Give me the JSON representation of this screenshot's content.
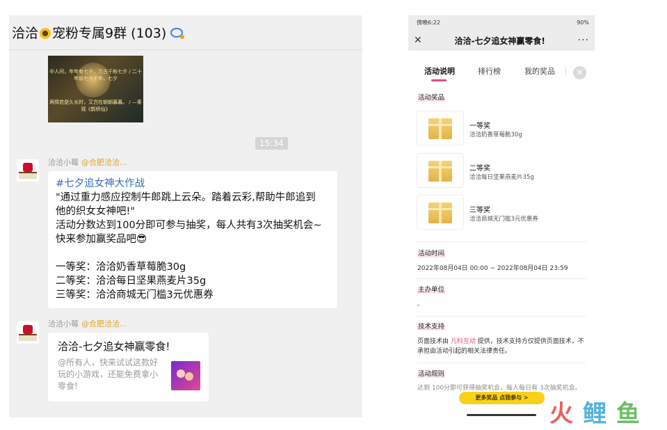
{
  "chat": {
    "title": "洽洽",
    "title_suffix": "宠粉专属9群 (103)",
    "image_caption_top": "中人间，年年有七夕，万古千秋七夕 / 二十年前七夕千年，七夕",
    "image_caption_bottom": "两情若是久长时，又岂在朝朝暮暮。 / —秦观《鹊桥仙》",
    "time": "15:34",
    "messages": [
      {
        "sender": "洽洽小莓",
        "group": "@合肥洽洽...",
        "hashtag": "#七夕追女神大作战",
        "body": "\"通过重力感应控制牛郎跳上云朵。踏着云彩,帮助牛郎追到\n他的织女女神吧!\"\n活动分数达到100分即可参与抽奖，每人共有3次抽奖机会~\n快来参加赢奖品吧😎\n\n一等奖：洽洽奶香草莓脆30g\n二等奖：洽洽每日坚果燕麦片35g\n三等奖：洽洽商城无门槛3元优惠券"
      },
      {
        "sender": "洽洽小莓",
        "group": "@合肥洽洽...",
        "card_title": "洽洽-七夕追女神赢零食!",
        "card_desc": "@所有人，快来试试这款好玩的小游戏，还能免费拿小零食!"
      }
    ]
  },
  "phone": {
    "status_left": "傍晚6:22",
    "status_right": "90%",
    "nav_title": "洽洽-七夕追女神赢零食!",
    "nav_close": "✕",
    "nav_more": "···",
    "tabs": [
      "活动说明",
      "排行榜",
      "我的奖品"
    ],
    "active_tab": "活动说明",
    "close_icon": "✕",
    "sections": {
      "prizes_label": "活动奖品",
      "prizes": [
        {
          "name": "一等奖",
          "desc": "洽洽奶香草莓脆30g"
        },
        {
          "name": "二等奖",
          "desc": "洽洽每日坚果燕麦片35g"
        },
        {
          "name": "三等奖",
          "desc": "洽洽商城无门槛3元优惠券"
        }
      ],
      "time_label": "活动时间",
      "time_value": "2022年08月04日 00:00 ~ 2022年08月04日 23:59",
      "host_label": "主办单位",
      "host_value": "-",
      "tech_label": "技术支持",
      "tech_pre": "页面技术由 ",
      "tech_link": "凡科互动",
      "tech_post": " 提供，技术支持方仅提供页面技术，不承担由活动引起的相关法律责任。",
      "rules_label": "活动规则",
      "rules_value": "达到 100分即可获得抽奖机会，每人每日有 3次抽奖机会。"
    },
    "cta": "更多奖品    点我参与 >"
  },
  "watermark": {
    "text": "火鲤鱼",
    "colors": [
      "#e8423f",
      "#34a6d8",
      "#52b44b"
    ]
  }
}
